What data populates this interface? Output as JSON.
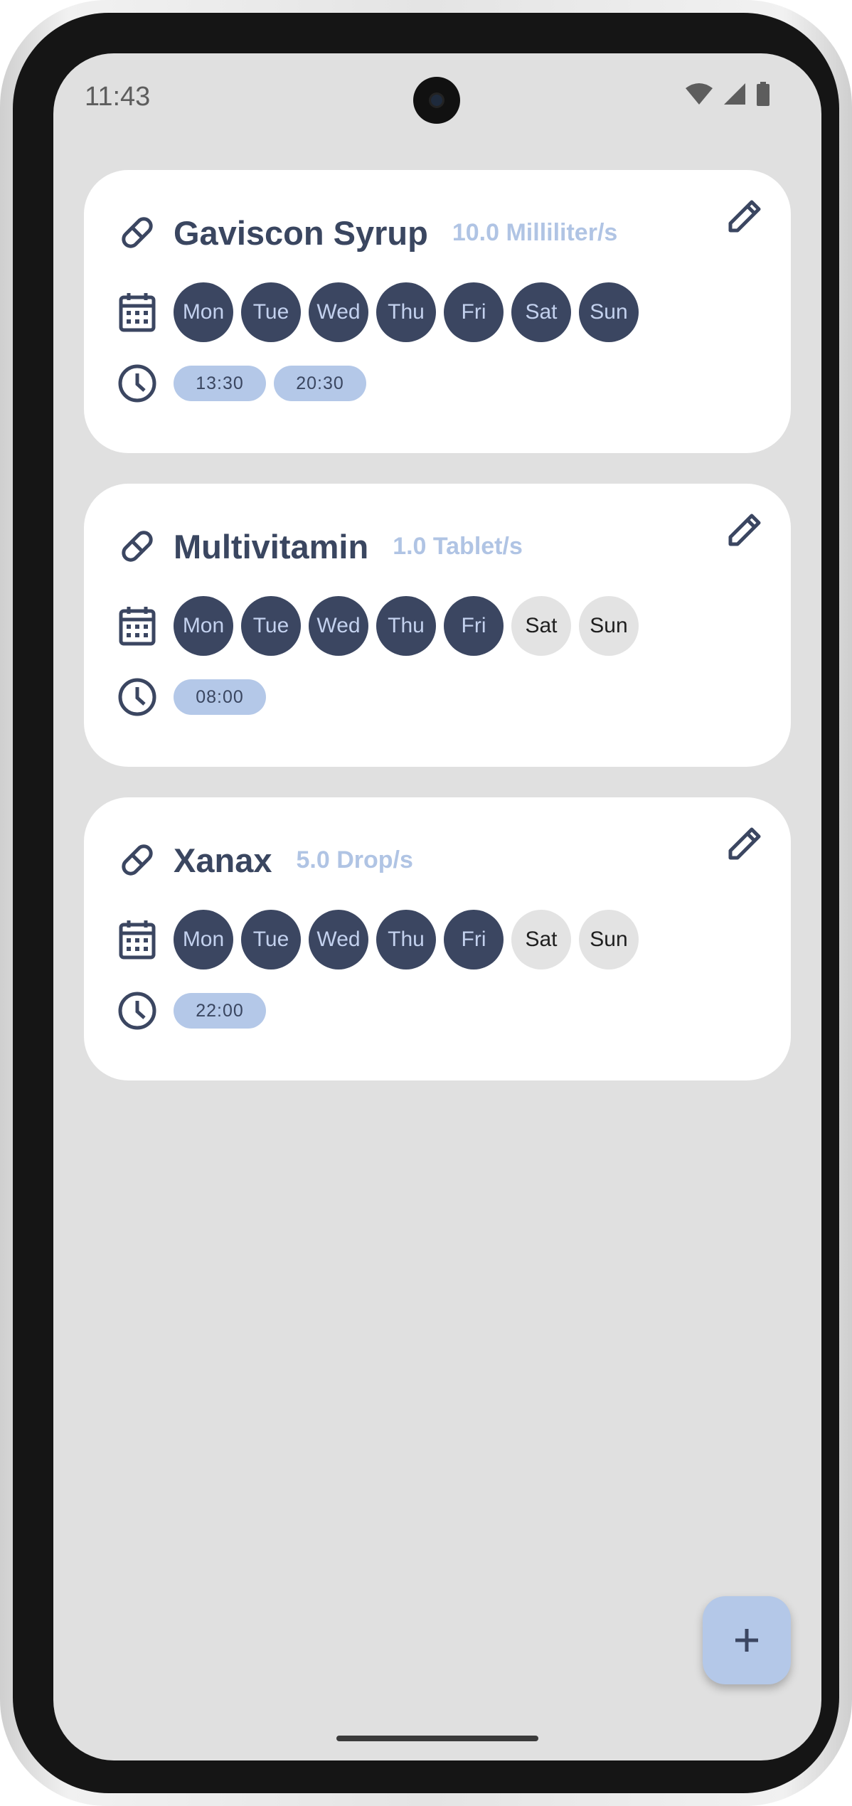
{
  "status_bar": {
    "time": "11:43",
    "icons": [
      "wifi-icon",
      "signal-icon",
      "battery-icon"
    ]
  },
  "medications": [
    {
      "name": "Gaviscon Syrup",
      "dose": "10.0 Milliliter/s",
      "days": [
        {
          "label": "Mon",
          "active": true
        },
        {
          "label": "Tue",
          "active": true
        },
        {
          "label": "Wed",
          "active": true
        },
        {
          "label": "Thu",
          "active": true
        },
        {
          "label": "Fri",
          "active": true
        },
        {
          "label": "Sat",
          "active": true
        },
        {
          "label": "Sun",
          "active": true
        }
      ],
      "times": [
        "13:30",
        "20:30"
      ]
    },
    {
      "name": "Multivitamin",
      "dose": "1.0 Tablet/s",
      "days": [
        {
          "label": "Mon",
          "active": true
        },
        {
          "label": "Tue",
          "active": true
        },
        {
          "label": "Wed",
          "active": true
        },
        {
          "label": "Thu",
          "active": true
        },
        {
          "label": "Fri",
          "active": true
        },
        {
          "label": "Sat",
          "active": false
        },
        {
          "label": "Sun",
          "active": false
        }
      ],
      "times": [
        "08:00"
      ]
    },
    {
      "name": "Xanax",
      "dose": "5.0 Drop/s",
      "days": [
        {
          "label": "Mon",
          "active": true
        },
        {
          "label": "Tue",
          "active": true
        },
        {
          "label": "Wed",
          "active": true
        },
        {
          "label": "Thu",
          "active": true
        },
        {
          "label": "Fri",
          "active": true
        },
        {
          "label": "Sat",
          "active": false
        },
        {
          "label": "Sun",
          "active": false
        }
      ],
      "times": [
        "22:00"
      ]
    }
  ],
  "fab": {
    "icon": "plus-icon"
  },
  "colors": {
    "background": "#e0e0e0",
    "card": "#ffffff",
    "accent_dark": "#3b4661",
    "accent_light": "#b4c8e8",
    "day_off": "#e3e3e3"
  }
}
